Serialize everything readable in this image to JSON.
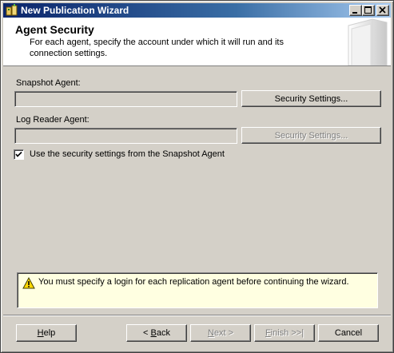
{
  "window": {
    "title": "New Publication Wizard"
  },
  "header": {
    "title": "Agent Security",
    "description": "For each agent, specify the account under which it will run and its connection settings."
  },
  "snapshot_agent": {
    "label": "Snapshot Agent:",
    "value": "",
    "button_label": "Security Settings..."
  },
  "log_reader_agent": {
    "label": "Log Reader Agent:",
    "value": "",
    "button_label": "Security Settings..."
  },
  "use_snapshot_settings": {
    "label": "Use the security settings from the Snapshot Agent",
    "checked": true
  },
  "message": {
    "text": "You must specify a login for each replication agent before continuing the wizard.",
    "icon": "warning-icon"
  },
  "footer": {
    "help": {
      "mnemonic": "H",
      "rest": "elp"
    },
    "back": {
      "prefix": "< ",
      "mnemonic": "B",
      "rest": "ack"
    },
    "next": {
      "mnemonic": "N",
      "rest": "ext >"
    },
    "finish": {
      "mnemonic": "F",
      "rest": "inish >>|"
    },
    "cancel": "Cancel"
  }
}
